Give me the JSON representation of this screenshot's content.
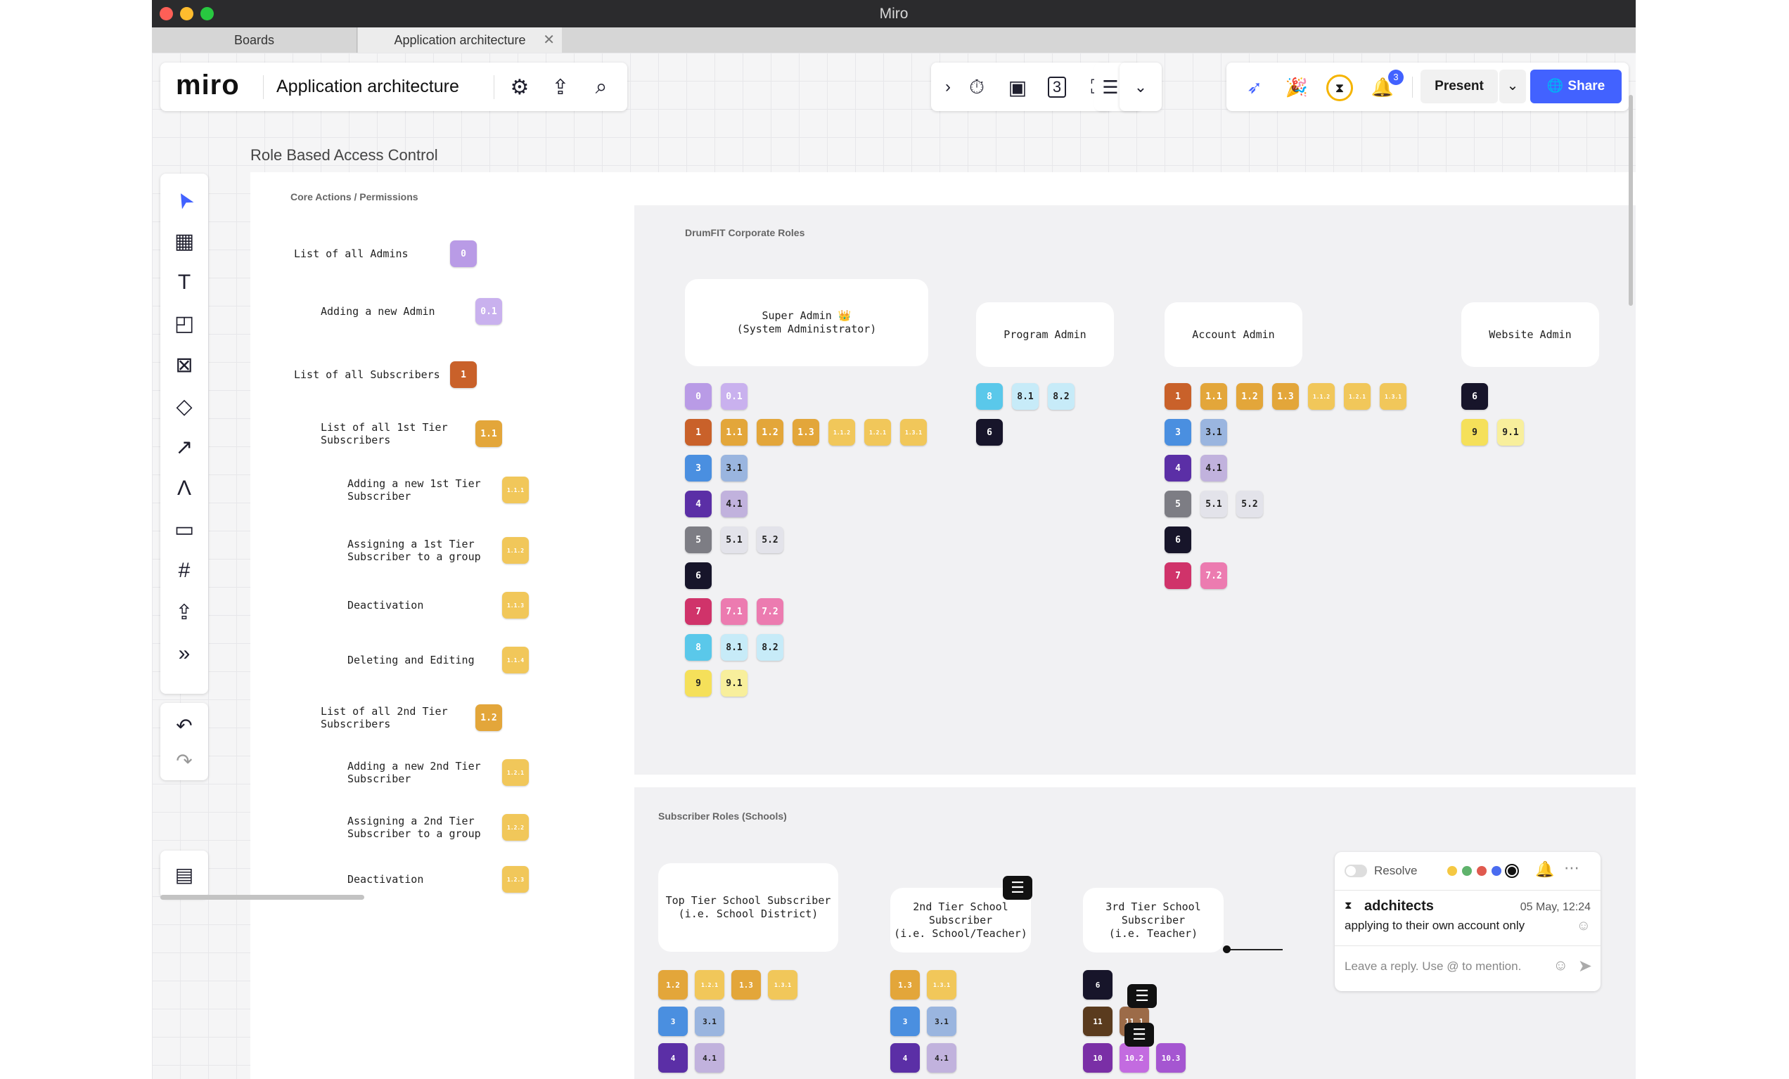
{
  "window": {
    "title": "Miro"
  },
  "tabs": [
    {
      "label": "Boards"
    },
    {
      "label": "Application architecture"
    }
  ],
  "topbar": {
    "logo": "miro",
    "board_name": "Application architecture",
    "notifications_count": "3",
    "present_label": "Present",
    "share_label": "Share"
  },
  "board": {
    "frame_title": "Role Based Access Control",
    "core_title": "Core Actions / Permissions",
    "corp_title": "DrumFIT Corporate Roles",
    "sub_title": "Subscriber Roles (Schools)",
    "permissions": [
      {
        "label": "List of all Admins",
        "badge": "0"
      },
      {
        "label": "Adding a new Admin",
        "badge": "0.1"
      },
      {
        "label": "List of all Subscribers",
        "badge": "1"
      },
      {
        "label": "List of all 1st Tier Subscribers",
        "badge": "1.1"
      },
      {
        "label": "Adding a new 1st Tier Subscriber",
        "badge": "1.1.1"
      },
      {
        "label": "Assigning a 1st Tier Subscriber to a group",
        "badge": "1.1.2"
      },
      {
        "label": "Deactivation",
        "badge": "1.1.3"
      },
      {
        "label": "Deleting and Editing",
        "badge": "1.1.4"
      },
      {
        "label": "List of all 2nd Tier Subscribers",
        "badge": "1.2"
      },
      {
        "label": "Adding a new 2nd Tier Subscriber",
        "badge": "1.2.1"
      },
      {
        "label": "Assigning a 2nd Tier Subscriber to a group",
        "badge": "1.2.2"
      },
      {
        "label": "Deactivation",
        "badge": "1.2.3"
      }
    ],
    "corp_roles": [
      {
        "label": "Super Admin 👑\n(System Administrator)"
      },
      {
        "label": "Program Admin"
      },
      {
        "label": "Account Admin"
      },
      {
        "label": "Website Admin"
      }
    ],
    "super_admin_badges": [
      [
        "0",
        "0.1"
      ],
      [
        "1",
        "1.1",
        "1.2",
        "1.3",
        "1.1.2",
        "1.2.1",
        "1.3.1"
      ],
      [
        "3",
        "3.1"
      ],
      [
        "4",
        "4.1"
      ],
      [
        "5",
        "5.1",
        "5.2"
      ],
      [
        "6"
      ],
      [
        "7",
        "7.1",
        "7.2"
      ],
      [
        "8",
        "8.1",
        "8.2"
      ],
      [
        "9",
        "9.1"
      ]
    ],
    "program_admin_badges": [
      [
        "8",
        "8.1",
        "8.2"
      ],
      [
        "6"
      ]
    ],
    "account_admin_badges": [
      [
        "1",
        "1.1",
        "1.2",
        "1.3",
        "1.1.2",
        "1.2.1",
        "1.3.1"
      ],
      [
        "3",
        "3.1"
      ],
      [
        "4",
        "4.1"
      ],
      [
        "5",
        "5.1",
        "5.2"
      ],
      [
        "6"
      ],
      [
        "7",
        "7.2"
      ]
    ],
    "website_admin_badges": [
      [
        "6"
      ],
      [
        "9",
        "9.1"
      ]
    ],
    "sub_roles": [
      {
        "label": "Top Tier School Subscriber\n(i.e. School District)"
      },
      {
        "label": "2nd Tier School\nSubscriber\n(i.e. School/Teacher)"
      },
      {
        "label": "3rd Tier School\nSubscriber\n(i.e. Teacher)"
      }
    ],
    "top_tier_badges": [
      [
        "1.2",
        "1.2.1",
        "1.3",
        "1.3.1"
      ],
      [
        "3",
        "3.1"
      ],
      [
        "4",
        "4.1"
      ]
    ],
    "second_tier_badges": [
      [
        "1.3",
        "1.3.1"
      ],
      [
        "3",
        "3.1"
      ],
      [
        "4",
        "4.1"
      ]
    ],
    "third_tier_badges": [
      [
        "6"
      ],
      [
        "11",
        "11.1"
      ],
      [
        "10",
        "10.2",
        "10.3"
      ]
    ]
  },
  "colors": {
    "0": "#b99be6",
    "0.1": "#c9b1ee",
    "1": "#c9612a",
    "1.1": "#e3a63a",
    "1.2": "#e3a63a",
    "1.3": "#e3a63a",
    "1.1.1": "#f1c75a",
    "1.1.2": "#f1c75a",
    "1.1.3": "#f1c75a",
    "1.1.4": "#f1c75a",
    "1.2.1": "#f1c75a",
    "1.2.2": "#f1c75a",
    "1.2.3": "#f1c75a",
    "1.3.1": "#f1c75a",
    "3": "#4a8fe0",
    "3.1": "#9ab5df",
    "4": "#5b2fa6",
    "4.1": "#c1b2dd",
    "5": "#7d7d84",
    "5.1": "#e3e3ea",
    "5.2": "#e3e3ea",
    "6": "#17152a",
    "7": "#d0336a",
    "7.1": "#ec7bb0",
    "7.2": "#ec7bb0",
    "8": "#5ac8ea",
    "8.1": "#c7ebf8",
    "8.2": "#c7ebf8",
    "9": "#f5e05a",
    "9.1": "#f8ef9c",
    "10": "#7a2fa6",
    "10.2": "#c36be0",
    "10.3": "#a556d1",
    "11": "#5a3b1e",
    "11.1": "#9c6b48"
  },
  "comment": {
    "resolve_label": "Resolve",
    "author": "adchitects",
    "time": "05 May, 12:24",
    "text": "applying to their own account only",
    "reply_placeholder": "Leave a reply. Use @ to mention."
  },
  "icons": {
    "toolbar": [
      "cursor-icon",
      "template-icon",
      "text-icon",
      "sticky-note-icon",
      "card-icon",
      "shapes-icon",
      "arrow-icon",
      "pen-icon",
      "comment-icon",
      "frame-icon",
      "upload-icon",
      "more-icon"
    ],
    "history": [
      "undo-icon",
      "redo-icon"
    ]
  }
}
